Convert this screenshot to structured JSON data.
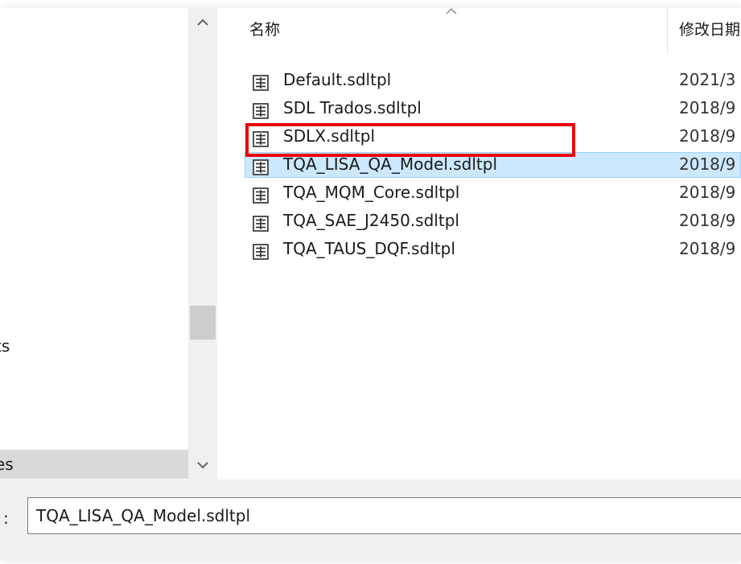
{
  "nav": {
    "items": [
      {
        "label": "ts"
      },
      {
        "label": "es"
      }
    ]
  },
  "columns": {
    "name": "名称",
    "date": "修改日期"
  },
  "files": [
    {
      "name": "Default.sdltpl",
      "date": "2021/3"
    },
    {
      "name": "SDL Trados.sdltpl",
      "date": "2018/9"
    },
    {
      "name": "SDLX.sdltpl",
      "date": "2018/9"
    },
    {
      "name": "TQA_LISA_QA_Model.sdltpl",
      "date": "2018/9",
      "selected": true
    },
    {
      "name": "TQA_MQM_Core.sdltpl",
      "date": "2018/9"
    },
    {
      "name": "TQA_SAE_J2450.sdltpl",
      "date": "2018/9"
    },
    {
      "name": "TQA_TAUS_DQF.sdltpl",
      "date": "2018/9"
    }
  ],
  "filename": {
    "label": ":",
    "value": "TQA_LISA_QA_Model.sdltpl"
  }
}
